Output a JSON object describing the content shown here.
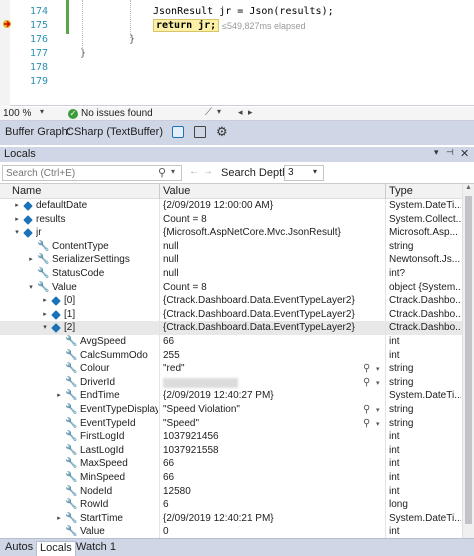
{
  "editor": {
    "lines": [
      {
        "num": "174",
        "code": "JsonResult jr = Json(results);"
      },
      {
        "num": "175",
        "code": "return jr;",
        "elapsed": "≤549,827ms elapsed"
      },
      {
        "num": "176",
        "code": "}"
      },
      {
        "num": "177",
        "code": "}"
      },
      {
        "num": "178",
        "code": ""
      },
      {
        "num": "179",
        "code": ""
      }
    ]
  },
  "editor_status": {
    "zoom": "100 %",
    "issues": "No issues found"
  },
  "buffer_graph": {
    "label": "Buffer Graph:",
    "value": "CSharp (TextBuffer)"
  },
  "locals": {
    "title": "Locals",
    "search_placeholder": "Search (Ctrl+E)",
    "search_depth_label": "Search Depth:",
    "search_depth_value": "3",
    "columns": {
      "name": "Name",
      "value": "Value",
      "type": "Type"
    },
    "rows": [
      {
        "name": "defaultDate",
        "value": "{2/09/2019 12:00:00 AM}",
        "type": "System.DateTi..."
      },
      {
        "name": "results",
        "value": "Count = 8",
        "type": "System.Collect..."
      },
      {
        "name": "jr",
        "value": "{Microsoft.AspNetCore.Mvc.JsonResult}",
        "type": "Microsoft.Asp..."
      },
      {
        "name": "ContentType",
        "value": "null",
        "type": "string"
      },
      {
        "name": "SerializerSettings",
        "value": "null",
        "type": "Newtonsoft.Js..."
      },
      {
        "name": "StatusCode",
        "value": "null",
        "type": "int?"
      },
      {
        "name": "Value",
        "value": "Count = 8",
        "type": "object {System..."
      },
      {
        "name": "[0]",
        "value": "{Ctrack.Dashboard.Data.EventTypeLayer2}",
        "type": "Ctrack.Dashbo..."
      },
      {
        "name": "[1]",
        "value": "{Ctrack.Dashboard.Data.EventTypeLayer2}",
        "type": "Ctrack.Dashbo..."
      },
      {
        "name": "[2]",
        "value": "{Ctrack.Dashboard.Data.EventTypeLayer2}",
        "type": "Ctrack.Dashbo..."
      },
      {
        "name": "AvgSpeed",
        "value": "66",
        "type": "int"
      },
      {
        "name": "CalcSummOdo",
        "value": "255",
        "type": "int"
      },
      {
        "name": "Colour",
        "value": "\"red\"",
        "type": "string"
      },
      {
        "name": "DriverId",
        "value": "",
        "type": "string"
      },
      {
        "name": "EndTime",
        "value": "{2/09/2019 12:40:27 PM}",
        "type": "System.DateTi..."
      },
      {
        "name": "EventTypeDisplay",
        "value": "\"Speed Violation\"",
        "type": "string"
      },
      {
        "name": "EventTypeId",
        "value": "\"Speed\"",
        "type": "string"
      },
      {
        "name": "FirstLogId",
        "value": "1037921456",
        "type": "int"
      },
      {
        "name": "LastLogId",
        "value": "1037921558",
        "type": "int"
      },
      {
        "name": "MaxSpeed",
        "value": "66",
        "type": "int"
      },
      {
        "name": "MinSpeed",
        "value": "66",
        "type": "int"
      },
      {
        "name": "NodeId",
        "value": "12580",
        "type": "int"
      },
      {
        "name": "RowId",
        "value": "6",
        "type": "long"
      },
      {
        "name": "StartTime",
        "value": "{2/09/2019 12:40:21 PM}",
        "type": "System.DateTi..."
      },
      {
        "name": "Value",
        "value": "0",
        "type": "int"
      }
    ]
  },
  "bottom_tabs": [
    "Autos",
    "Locals",
    "Watch 1"
  ]
}
